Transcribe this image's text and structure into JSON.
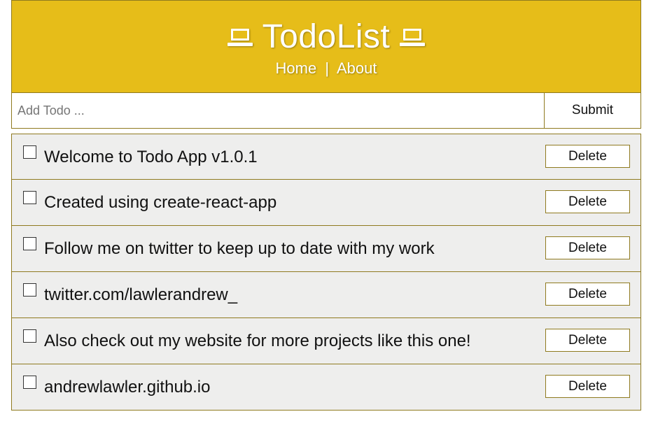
{
  "header": {
    "title": "TodoList",
    "left_icon": "laptop-icon",
    "right_icon": "laptop-icon",
    "nav": {
      "home": "Home",
      "separator": "|",
      "about": "About"
    },
    "background_color": "#e6bd19"
  },
  "add_form": {
    "placeholder": "Add Todo ...",
    "value": "",
    "submit_label": "Submit"
  },
  "todos": [
    {
      "title": "Welcome to Todo App v1.0.1",
      "completed": false,
      "delete_label": "Delete"
    },
    {
      "title": "Created using create-react-app",
      "completed": false,
      "delete_label": "Delete"
    },
    {
      "title": "Follow me on twitter to keep up to date with my work",
      "completed": false,
      "delete_label": "Delete"
    },
    {
      "title": "twitter.com/lawlerandrew_",
      "completed": false,
      "delete_label": "Delete"
    },
    {
      "title": "Also check out my website for more projects like this one!",
      "completed": false,
      "delete_label": "Delete"
    },
    {
      "title": "andrewlawler.github.io",
      "completed": false,
      "delete_label": "Delete"
    }
  ],
  "colors": {
    "accent": "#e6bd19",
    "border": "#8f7a1f",
    "item_background": "#eeeeed"
  }
}
